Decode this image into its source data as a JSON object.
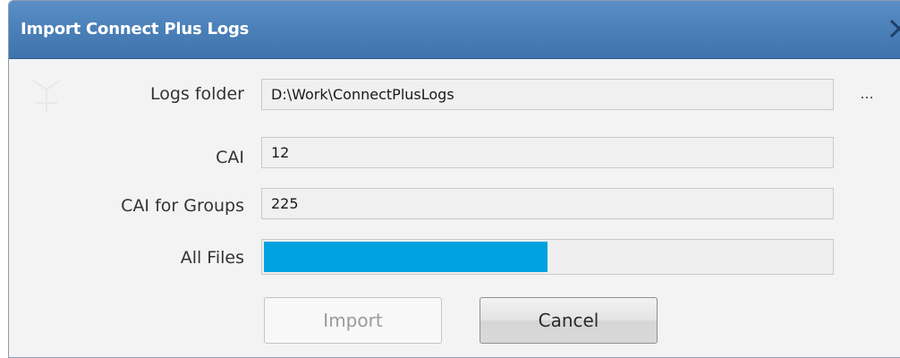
{
  "dialog": {
    "title": "Import Connect Plus Logs"
  },
  "fields": {
    "logs_folder": {
      "label": "Logs folder",
      "value": "D:\\Work\\ConnectPlusLogs",
      "browse_label": "..."
    },
    "cai": {
      "label": "CAI",
      "value": "12"
    },
    "cai_groups": {
      "label": "CAI for Groups",
      "value": "225"
    }
  },
  "progress": {
    "label": "All Files",
    "fraction": 0.5,
    "color": "#00a2e0"
  },
  "buttons": {
    "import_label": "Import",
    "cancel_label": "Cancel"
  },
  "icons": {
    "close": "close-icon"
  }
}
